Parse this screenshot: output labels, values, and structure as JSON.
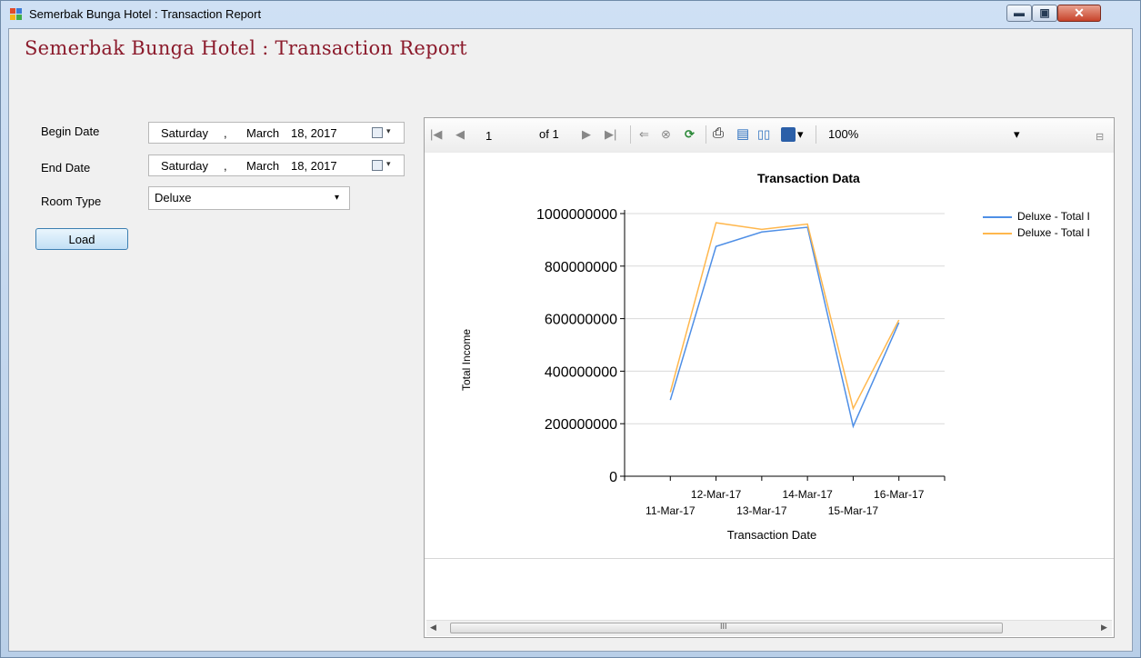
{
  "window": {
    "title": "Semerbak Bunga Hotel : Transaction Report",
    "min_glyph": "▬",
    "max_glyph": "▣",
    "close_glyph": "✕"
  },
  "form": {
    "heading": "Semerbak Bunga Hotel : Transaction Report",
    "begin_label": "Begin Date",
    "end_label": "End Date",
    "room_label": "Room Type",
    "begin_date": {
      "weekday": "Saturday",
      "sep": ",",
      "month": "March",
      "day_year": "18, 2017"
    },
    "end_date": {
      "weekday": "Saturday",
      "sep": ",",
      "month": "March",
      "day_year": "18, 2017"
    },
    "room_type": "Deluxe",
    "load_label": "Load"
  },
  "toolbar": {
    "page_value": "1",
    "of_pages": "of 1",
    "zoom": "100%",
    "first_glyph": "|◀",
    "prev_glyph": "◀",
    "next_glyph": "▶",
    "last_glyph": "▶|",
    "back_glyph": "⇐",
    "stop_glyph": "⊗",
    "refresh_glyph": "⟳",
    "print_glyph": "⎙",
    "layout_glyph": "▤",
    "pagesetup_glyph": "▯▯",
    "export_glyph": "▾",
    "zoom_arrow": "▾",
    "overflow_glyph": "⊟"
  },
  "icons": {
    "app": "app-window-icon",
    "calendar": "calendar-icon",
    "first_page": "first-page-icon",
    "prev_page": "previous-page-icon",
    "next_page": "next-page-icon",
    "last_page": "last-page-icon",
    "back": "back-icon",
    "stop": "stop-icon",
    "refresh": "refresh-icon",
    "print": "printer-icon",
    "print_layout": "print-layout-icon",
    "page_setup": "page-setup-icon",
    "export": "save-export-icon"
  },
  "colors": {
    "heading": "#8b1a2b",
    "series1": "#4f8fe6",
    "series2": "#ffb74d"
  },
  "chart_data": {
    "type": "line",
    "title": "Transaction Data",
    "xlabel": "Transaction Date",
    "ylabel": "Total Income",
    "categories": [
      "11-Mar-17",
      "12-Mar-17",
      "13-Mar-17",
      "14-Mar-17",
      "15-Mar-17",
      "16-Mar-17"
    ],
    "yticks": [
      "0",
      "200000000",
      "400000000",
      "600000000",
      "800000000",
      "1000000000"
    ],
    "ylim": [
      0,
      1000000000
    ],
    "grid": true,
    "legend_position": "right",
    "series": [
      {
        "name": "Deluxe - Total I",
        "color": "#4f8fe6",
        "values": [
          290000000,
          875000000,
          930000000,
          948000000,
          190000000,
          585000000
        ]
      },
      {
        "name": "Deluxe - Total I",
        "color": "#ffb74d",
        "values": [
          320000000,
          965000000,
          940000000,
          960000000,
          258000000,
          595000000
        ]
      }
    ]
  },
  "scrollbar": {
    "left_arrow": "◀",
    "right_arrow": "▶",
    "grip": "III"
  }
}
